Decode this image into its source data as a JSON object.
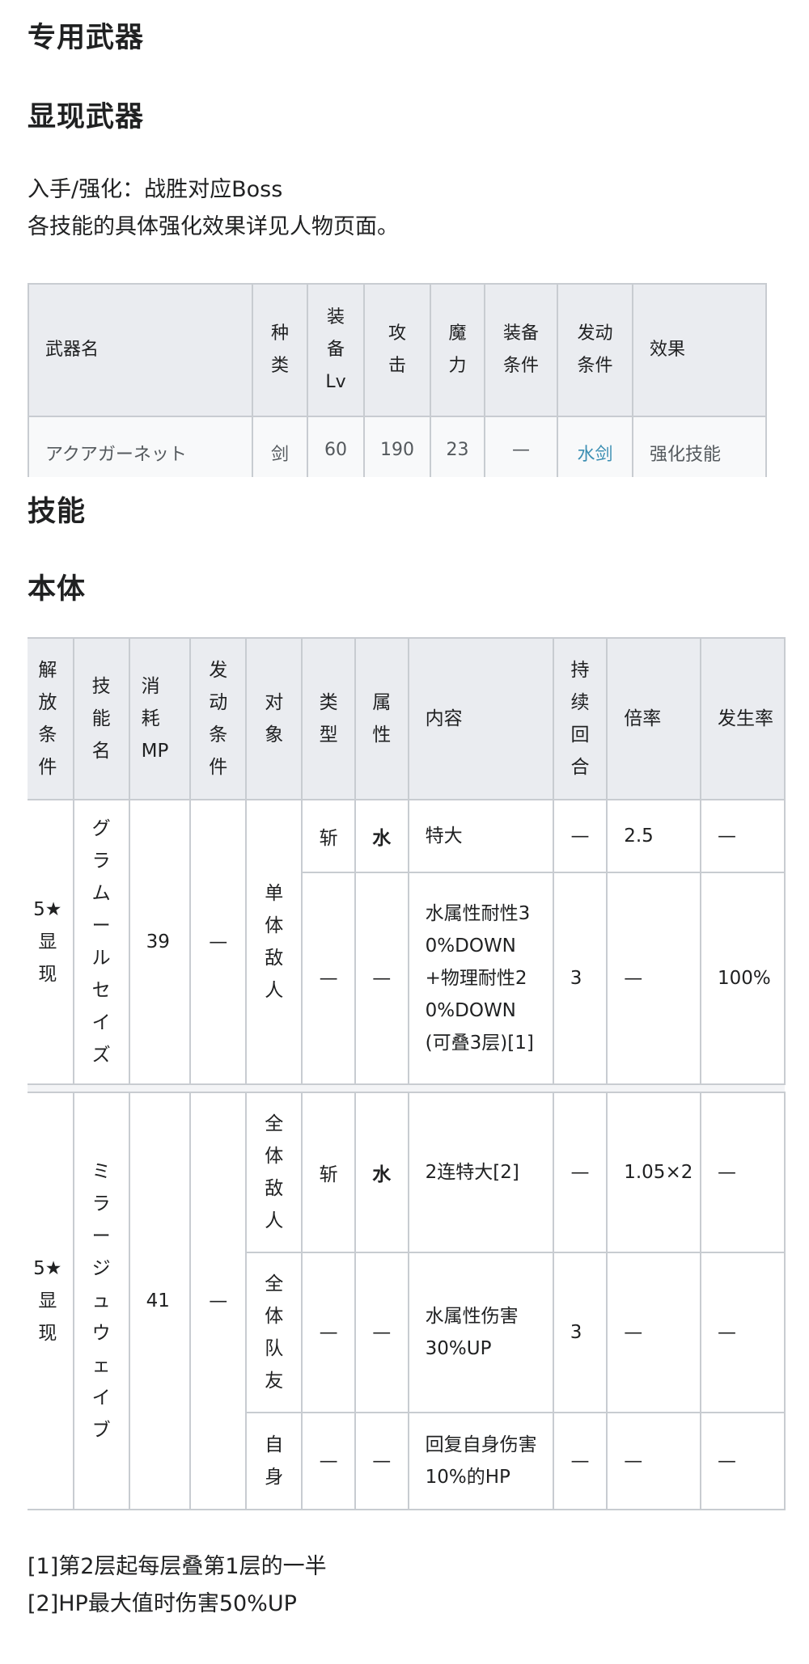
{
  "section_title": "专用武器",
  "weapon_title": "显现武器",
  "weapon_desc": [
    "入手/强化：战胜对应Boss",
    "各技能的具体强化效果详见人物页面。"
  ],
  "weapon_table": {
    "headers": [
      "武器名",
      "种类",
      "装备Lv",
      "攻击",
      "魔力",
      "装备条件",
      "发动条件",
      "效果"
    ],
    "row": {
      "name": "アクアガーネット",
      "type": "剑",
      "lv": "60",
      "atk": "190",
      "mag": "23",
      "equip_cond": "—",
      "trigger": "水剑",
      "effect": "强化技能"
    }
  },
  "skills_title": "技能",
  "body_title": "本体",
  "skill_table": {
    "headers": [
      "解放条件",
      "技能名",
      "消耗MP",
      "发动条件",
      "对象",
      "类型",
      "属性",
      "内容",
      "持续回合",
      "倍率",
      "发生率"
    ],
    "skill1": {
      "unlock": "5★显现",
      "name": "グラムールセイズ",
      "mp": "39",
      "trigger": "—",
      "target": "单体敌人",
      "row_a": {
        "kind": "斩",
        "attr": "水",
        "content": "特大",
        "turns": "—",
        "rate": "2.5",
        "chance": "—"
      },
      "row_b": {
        "kind": "—",
        "attr": "—",
        "content": "水属性耐性30%DOWN+物理耐性20%DOWN(可叠3层)[1]",
        "turns": "3",
        "rate": "—",
        "chance": "100%"
      }
    },
    "skill2": {
      "unlock": "5★显现",
      "name": "ミラージュウェイブ",
      "mp": "41",
      "trigger": "—",
      "row_a": {
        "target": "全体敌人",
        "kind": "斩",
        "attr": "水",
        "content": "2连特大[2]",
        "turns": "—",
        "rate": "1.05×2",
        "chance": "—"
      },
      "row_b": {
        "target": "全体队友",
        "kind": "—",
        "attr": "—",
        "content": "水属性伤害30%UP",
        "turns": "3",
        "rate": "—",
        "chance": "—"
      },
      "row_c": {
        "target": "自身",
        "kind": "—",
        "attr": "—",
        "content": "回复自身伤害10%的HP",
        "turns": "—",
        "rate": "—",
        "chance": "—"
      }
    }
  },
  "notes": [
    "[1]第2层起每层叠第1层的一半",
    "[2]HP最大值时伤害50%UP"
  ]
}
